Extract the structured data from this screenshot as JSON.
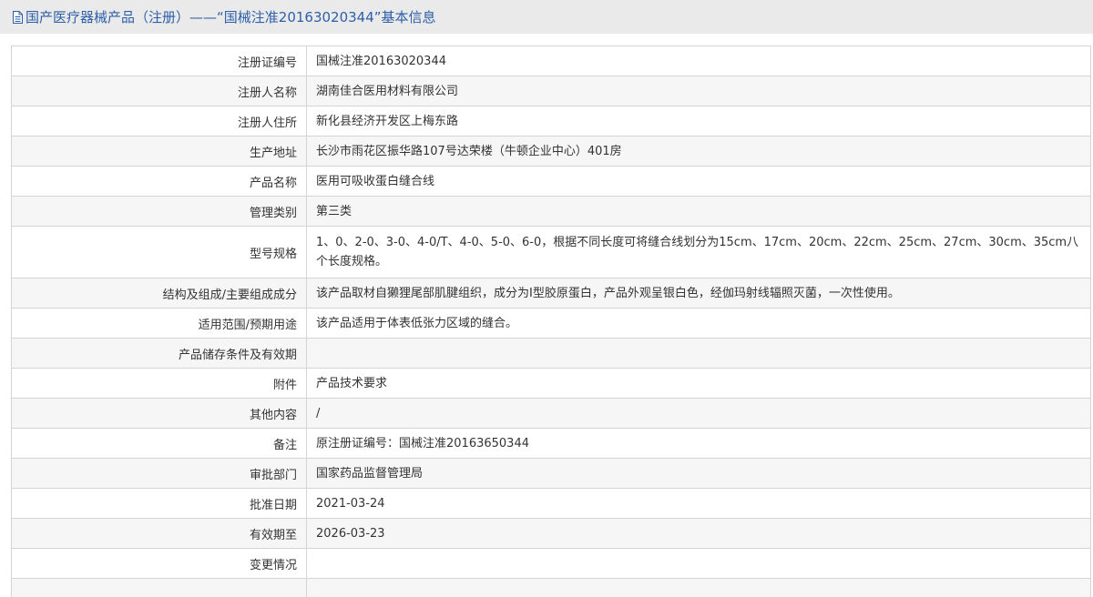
{
  "header": {
    "icon": "document-icon",
    "title": "国产医疗器械产品（注册）——“国械注准20163020344”基本信息"
  },
  "rows": [
    {
      "label": "注册证编号",
      "value": "国械注准20163020344"
    },
    {
      "label": "注册人名称",
      "value": "湖南佳合医用材料有限公司"
    },
    {
      "label": "注册人住所",
      "value": "新化县经济开发区上梅东路"
    },
    {
      "label": "生产地址",
      "value": "长沙市雨花区振华路107号达荣楼（牛顿企业中心）401房"
    },
    {
      "label": "产品名称",
      "value": "医用可吸收蛋白缝合线"
    },
    {
      "label": "管理类别",
      "value": "第三类"
    },
    {
      "label": "型号规格",
      "value": "1、0、2-0、3-0、4-0/T、4-0、5-0、6-0，根据不同长度可将缝合线划分为15cm、17cm、20cm、22cm、25cm、27cm、30cm、35cm八个长度规格。"
    },
    {
      "label": "结构及组成/主要组成成分",
      "value": "该产品取材自獭狸尾部肌腱组织，成分为I型胶原蛋白，产品外观呈银白色，经伽玛射线辐照灭菌，一次性使用。"
    },
    {
      "label": "适用范围/预期用途",
      "value": "该产品适用于体表低张力区域的缝合。"
    },
    {
      "label": "产品储存条件及有效期",
      "value": ""
    },
    {
      "label": "附件",
      "value": "产品技术要求"
    },
    {
      "label": "其他内容",
      "value": "/"
    },
    {
      "label": "备注",
      "value": "原注册证编号：国械注准20163650344"
    },
    {
      "label": "审批部门",
      "value": "国家药品监督管理局"
    },
    {
      "label": "批准日期",
      "value": "2021-03-24"
    },
    {
      "label": "有效期至",
      "value": "2026-03-23"
    },
    {
      "label": "变更情况",
      "value": ""
    }
  ]
}
